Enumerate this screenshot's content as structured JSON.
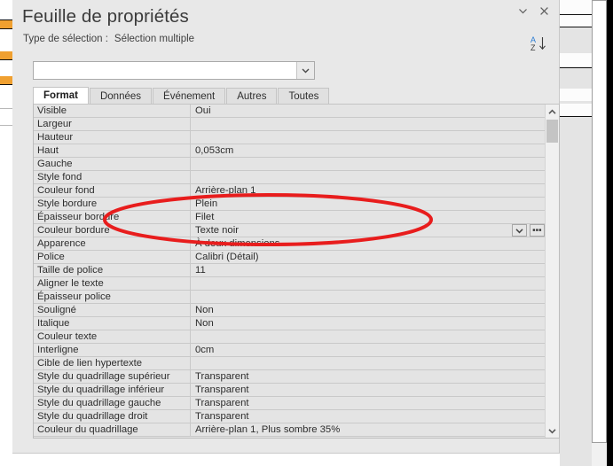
{
  "window": {
    "title": "Feuille de propriétés",
    "collapse_icon": "chevron-down-icon",
    "close_icon": "close-icon",
    "sort_icon": "sort-az-icon",
    "sort_icon_letters": {
      "top": "A",
      "bottom": "Z"
    },
    "sort_icon_top_color": "#2b7cd3"
  },
  "selection": {
    "label": "Type de sélection :",
    "value": "Sélection multiple"
  },
  "object_combo": {
    "value": "",
    "placeholder": "",
    "arrow_icon": "chevron-down-icon"
  },
  "tabs": [
    {
      "label": "Format",
      "active": true
    },
    {
      "label": "Données",
      "active": false
    },
    {
      "label": "Événement",
      "active": false
    },
    {
      "label": "Autres",
      "active": false
    },
    {
      "label": "Toutes",
      "active": false
    }
  ],
  "properties": [
    {
      "name": "Visible",
      "value": "Oui"
    },
    {
      "name": "Largeur",
      "value": ""
    },
    {
      "name": "Hauteur",
      "value": ""
    },
    {
      "name": "Haut",
      "value": "0,053cm"
    },
    {
      "name": "Gauche",
      "value": ""
    },
    {
      "name": "Style fond",
      "value": ""
    },
    {
      "name": "Couleur fond",
      "value": "Arrière-plan 1"
    },
    {
      "name": "Style bordure",
      "value": "Plein"
    },
    {
      "name": "Épaisseur bordure",
      "value": "Filet"
    },
    {
      "name": "Couleur bordure",
      "value": "Texte noir",
      "selected": true,
      "editors": [
        "chevron-down-icon",
        "builder-ellipsis-icon"
      ]
    },
    {
      "name": "Apparence",
      "value": "À deux dimensions"
    },
    {
      "name": "Police",
      "value": "Calibri (Détail)"
    },
    {
      "name": "Taille de police",
      "value": "11"
    },
    {
      "name": "Aligner le texte",
      "value": ""
    },
    {
      "name": "Épaisseur police",
      "value": ""
    },
    {
      "name": "Souligné",
      "value": "Non"
    },
    {
      "name": "Italique",
      "value": "Non"
    },
    {
      "name": "Couleur texte",
      "value": ""
    },
    {
      "name": "Interligne",
      "value": "0cm"
    },
    {
      "name": "Cible de lien hypertexte",
      "value": ""
    },
    {
      "name": "Style du quadrillage supérieur",
      "value": "Transparent"
    },
    {
      "name": "Style du quadrillage inférieur",
      "value": "Transparent"
    },
    {
      "name": "Style du quadrillage gauche",
      "value": "Transparent"
    },
    {
      "name": "Style du quadrillage droit",
      "value": "Transparent"
    },
    {
      "name": "Couleur du quadrillage",
      "value": "Arrière-plan 1, Plus sombre 35%"
    }
  ],
  "scrollbar": {
    "up_icon": "caret-up-icon",
    "down_icon": "caret-down-icon"
  },
  "annotation": {
    "shape": "ellipse",
    "color": "#e81d1d",
    "stroke_width": 4
  }
}
